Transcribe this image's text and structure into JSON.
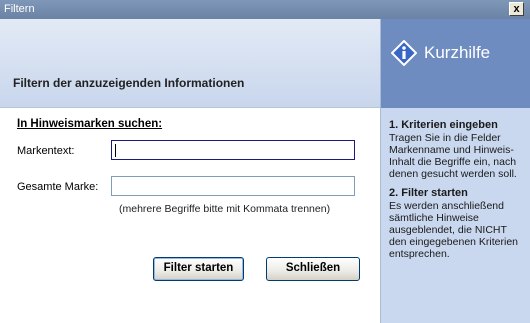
{
  "window": {
    "title": "Filtern",
    "close_symbol": "x"
  },
  "header": {
    "title": "Filtern der anzuzeigenden Informationen"
  },
  "form": {
    "section_title": "In Hinweismarken suchen:",
    "marker_text_label": "Markentext:",
    "marker_text_value": "",
    "whole_marker_label": "Gesamte Marke:",
    "whole_marker_value": "",
    "hint": "(mehrere Begriffe bitte mit Kommata trennen)"
  },
  "buttons": {
    "start": "Filter starten",
    "close": "Schließen"
  },
  "help": {
    "title": "Kurzhilfe",
    "step1_title": "1. Kriterien eingeben",
    "step1_text": "Tragen Sie in die Felder Markenname und Hinweis-Inhalt die Begriffe ein, nach denen gesucht werden soll.",
    "step2_title": "2. Filter starten",
    "step2_text": "Es werden anschließend sämtliche Hinweise ausgeblendet, die NICHT den eingegebenen Kriterien entsprechen."
  },
  "colors": {
    "sidebar_header": "#6f8cc0",
    "sidebar_bg": "#c9d8ef",
    "titlebar": "#6a83a6"
  }
}
